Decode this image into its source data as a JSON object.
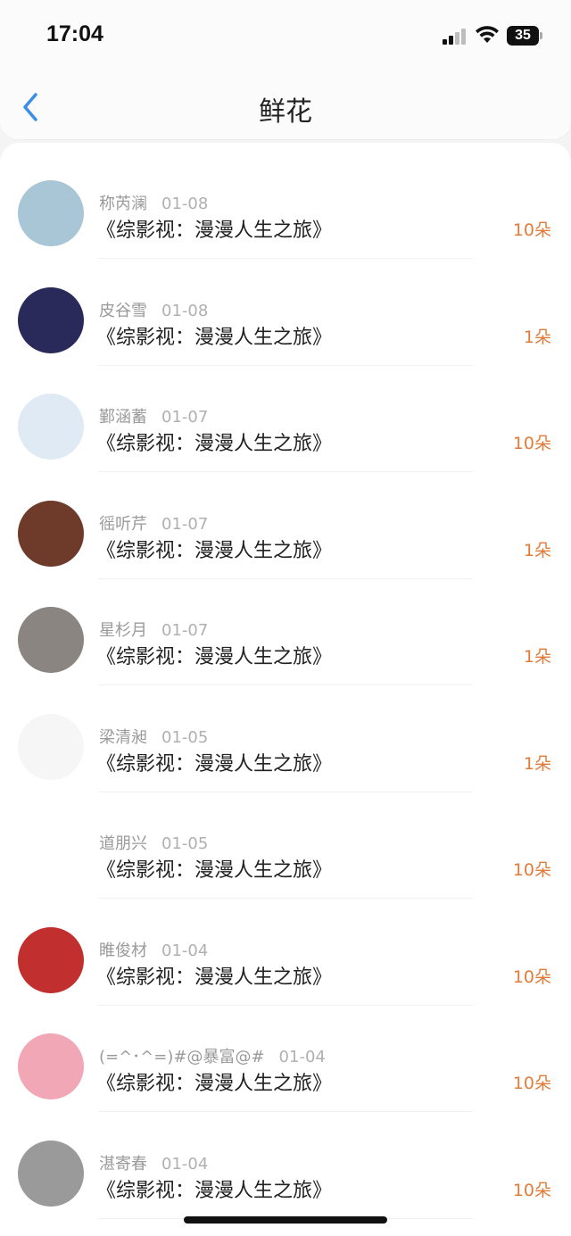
{
  "status_bar": {
    "time": "17:04",
    "battery": "35"
  },
  "header": {
    "title": "鲜花",
    "back_icon": "chevron-left-icon"
  },
  "colors": {
    "accent_blue": "#3a8ee6",
    "flower_count": "#e07b3a"
  },
  "list": [
    {
      "name": "称芮澜",
      "date": "01-08",
      "book": "《综影视：漫漫人生之旅》",
      "count": "10朵",
      "avatar_color": "#a9c6d6"
    },
    {
      "name": "皮谷雪",
      "date": "01-08",
      "book": "《综影视：漫漫人生之旅》",
      "count": "1朵",
      "avatar_color": "#2a2a5a"
    },
    {
      "name": "鄞涵蓄",
      "date": "01-07",
      "book": "《综影视：漫漫人生之旅》",
      "count": "10朵",
      "avatar_color": "#dfeaf5"
    },
    {
      "name": "徭听芹",
      "date": "01-07",
      "book": "《综影视：漫漫人生之旅》",
      "count": "1朵",
      "avatar_color": "#6e3b2a"
    },
    {
      "name": "星杉月",
      "date": "01-07",
      "book": "《综影视：漫漫人生之旅》",
      "count": "1朵",
      "avatar_color": "#8a8580"
    },
    {
      "name": "梁清昶",
      "date": "01-05",
      "book": "《综影视：漫漫人生之旅》",
      "count": "1朵",
      "avatar_color": "#f6f6f6"
    },
    {
      "name": "道朋兴",
      "date": "01-05",
      "book": "《综影视：漫漫人生之旅》",
      "count": "10朵",
      "avatar_color": "#ffffff"
    },
    {
      "name": "睢俊材",
      "date": "01-04",
      "book": "《综影视：漫漫人生之旅》",
      "count": "10朵",
      "avatar_color": "#c22f2f"
    },
    {
      "name": "(=^･^=)#@暴富@#",
      "date": "01-04",
      "book": "《综影视：漫漫人生之旅》",
      "count": "10朵",
      "avatar_color": "#f2a7b7"
    },
    {
      "name": "湛寄春",
      "date": "01-04",
      "book": "《综影视：漫漫人生之旅》",
      "count": "10朵",
      "avatar_color": "#9a9a9a"
    }
  ]
}
